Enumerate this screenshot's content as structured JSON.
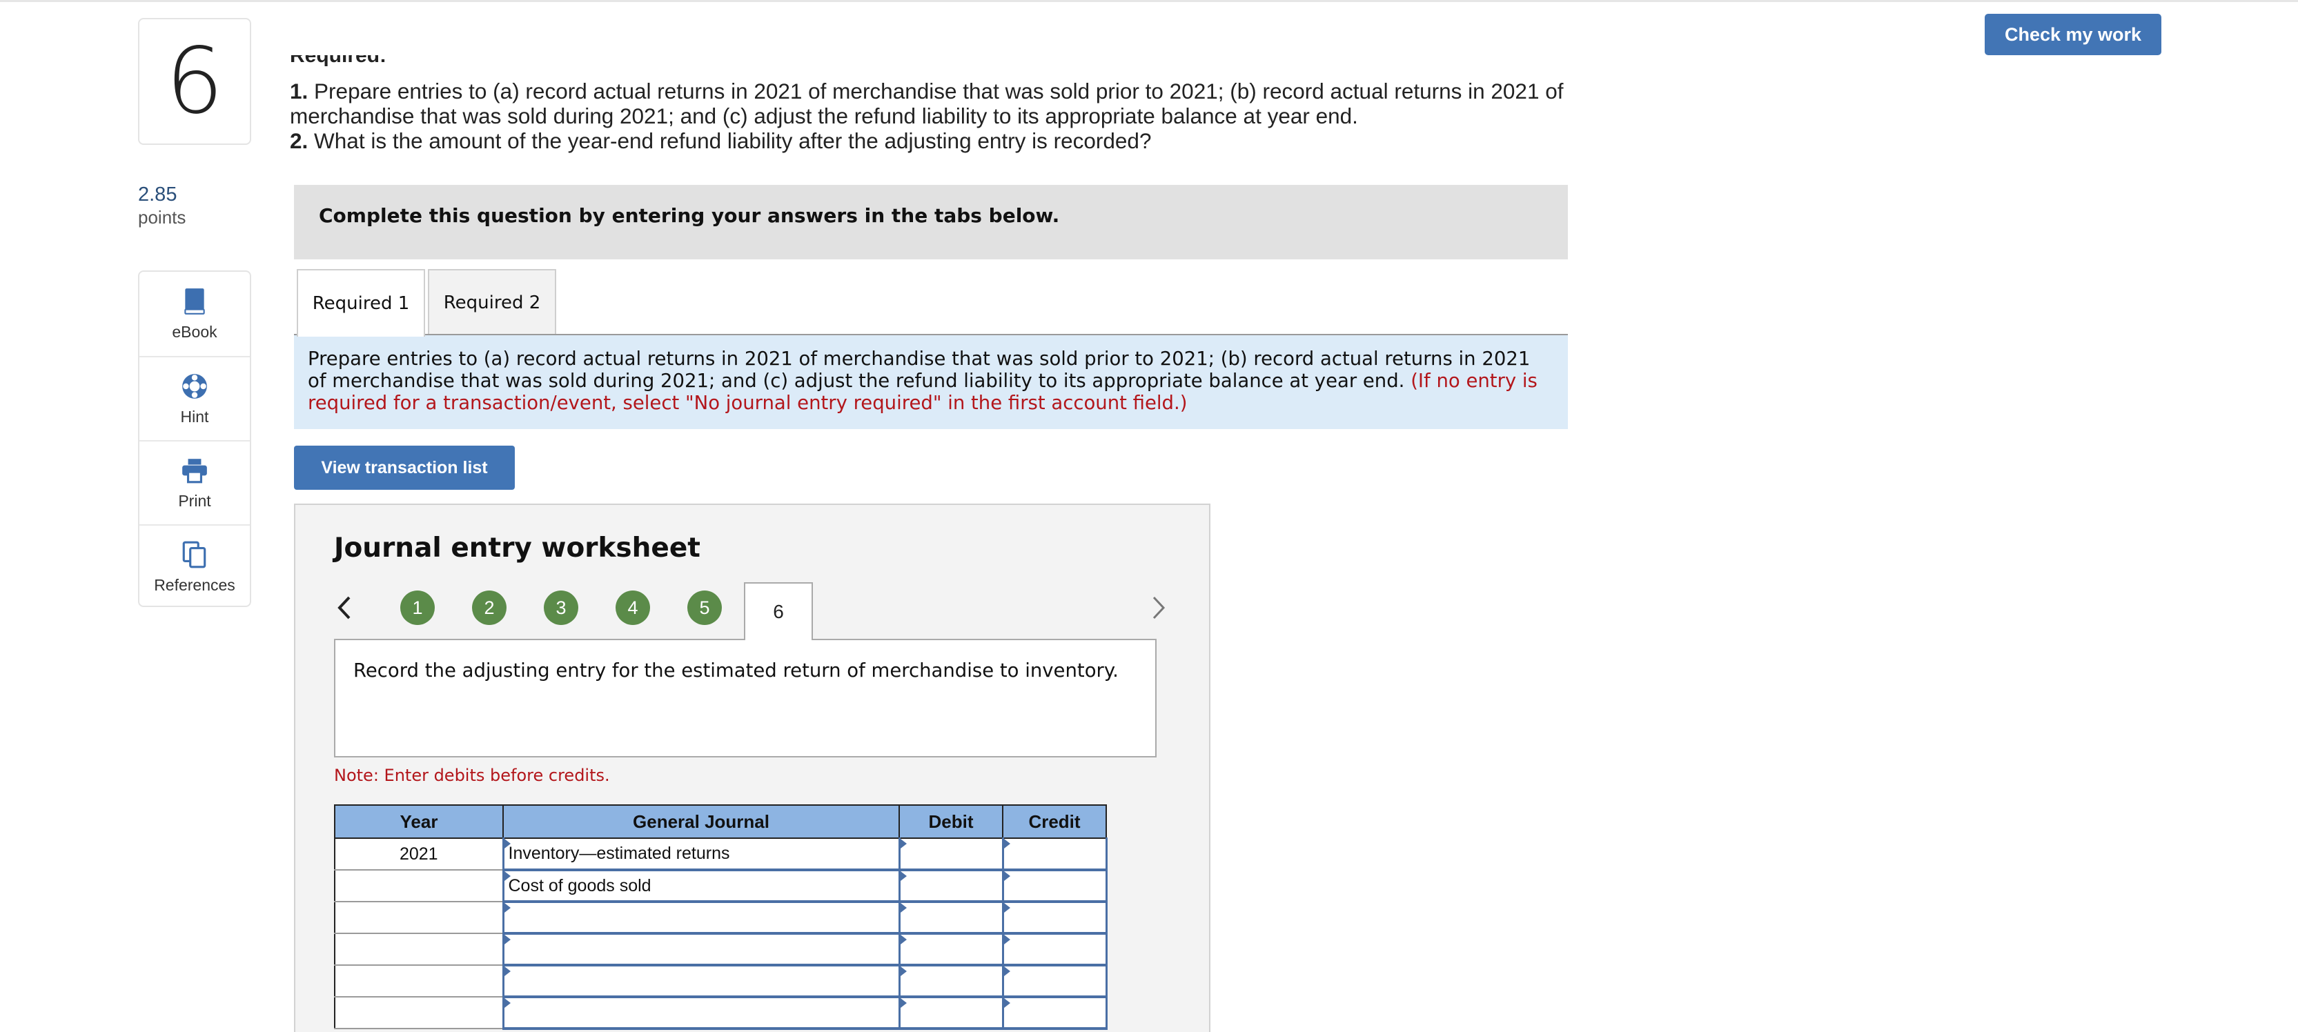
{
  "question": {
    "number": "6",
    "points_value": "2.85",
    "points_label": "points"
  },
  "tools": [
    {
      "label": "eBook",
      "icon": "book-icon"
    },
    {
      "label": "Hint",
      "icon": "lifebuoy-icon"
    },
    {
      "label": "Print",
      "icon": "printer-icon"
    },
    {
      "label": "References",
      "icon": "copy-icon"
    }
  ],
  "header": {
    "check_label": "Check my work"
  },
  "required": {
    "heading": "Required:",
    "item1_num": "1.",
    "item1_text": "Prepare entries to (a) record actual returns in 2021 of merchandise that was sold prior to 2021; (b) record actual returns in 2021 of merchandise that was sold during 2021; and (c) adjust the refund liability to its appropriate balance at year end.",
    "item2_num": "2.",
    "item2_text": "What is the amount of the year-end refund liability after the adjusting entry is recorded?"
  },
  "banner": "Complete this question by entering your answers in the tabs below.",
  "tabs": [
    {
      "label": "Required 1"
    },
    {
      "label": "Required 2"
    }
  ],
  "instructions": {
    "text": "Prepare entries to (a) record actual returns in 2021 of merchandise that was sold prior to 2021; (b) record actual returns in 2021 of merchandise that was sold during 2021; and (c) adjust the refund liability to its appropriate balance at year end.",
    "red": "(If no entry is required for a transaction/event, select \"No journal entry required\" in the first account field.)"
  },
  "view_button": "View transaction list",
  "worksheet": {
    "title": "Journal entry worksheet",
    "steps": [
      "1",
      "2",
      "3",
      "4",
      "5"
    ],
    "active_step": "6",
    "prompt": "Record the adjusting entry for the estimated return of merchandise to inventory.",
    "note": "Note: Enter debits before credits.",
    "columns": [
      "Year",
      "General Journal",
      "Debit",
      "Credit"
    ],
    "rows": [
      {
        "year": "2021",
        "account": "Inventory—estimated returns",
        "debit": "",
        "credit": ""
      },
      {
        "year": "",
        "account": "Cost of goods sold",
        "debit": "",
        "credit": ""
      },
      {
        "year": "",
        "account": "",
        "debit": "",
        "credit": ""
      },
      {
        "year": "",
        "account": "",
        "debit": "",
        "credit": ""
      },
      {
        "year": "",
        "account": "",
        "debit": "",
        "credit": ""
      },
      {
        "year": "",
        "account": "",
        "debit": "",
        "credit": ""
      }
    ]
  },
  "colors": {
    "accent_blue": "#4275b5",
    "step_green": "#5b8b49",
    "header_blue": "#8db4e2",
    "error_red": "#b3161b",
    "info_bg": "#dcebf8"
  }
}
